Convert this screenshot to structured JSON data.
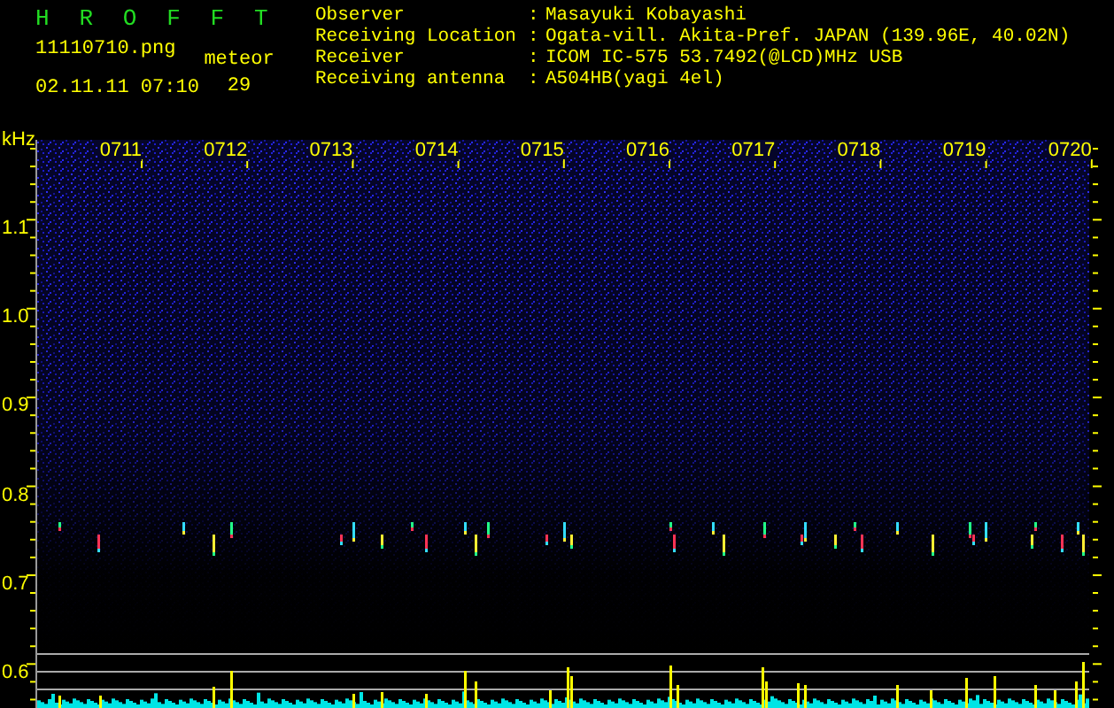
{
  "app": {
    "title": "H R O F F T",
    "filename": "11110710.png",
    "timestamp": "02.11.11 07:10",
    "count_label": "meteor",
    "count": "29"
  },
  "station_info": [
    {
      "label": "Observer",
      "separator": ":",
      "value": "Masayuki Kobayashi"
    },
    {
      "label": "Receiving Location",
      "separator": ":",
      "value": "Ogata-vill. Akita-Pref. JAPAN (139.96E, 40.02N)"
    },
    {
      "label": "Receiver",
      "separator": ":",
      "value": "ICOM IC-575 53.7492(@LCD)MHz USB"
    },
    {
      "label": "Receiving antenna",
      "separator": ":",
      "value": "A504HB(yagi 4el)"
    }
  ],
  "spectrogram": {
    "unit": "kHz",
    "frequency_labels": [
      "1.1",
      "1.0",
      "0.9",
      "0.8",
      "0.7",
      "0.6"
    ],
    "time_labels": [
      "0711",
      "0712",
      "0713",
      "0714",
      "0715",
      "0716",
      "0717",
      "0718",
      "0719",
      "0720"
    ]
  }
}
